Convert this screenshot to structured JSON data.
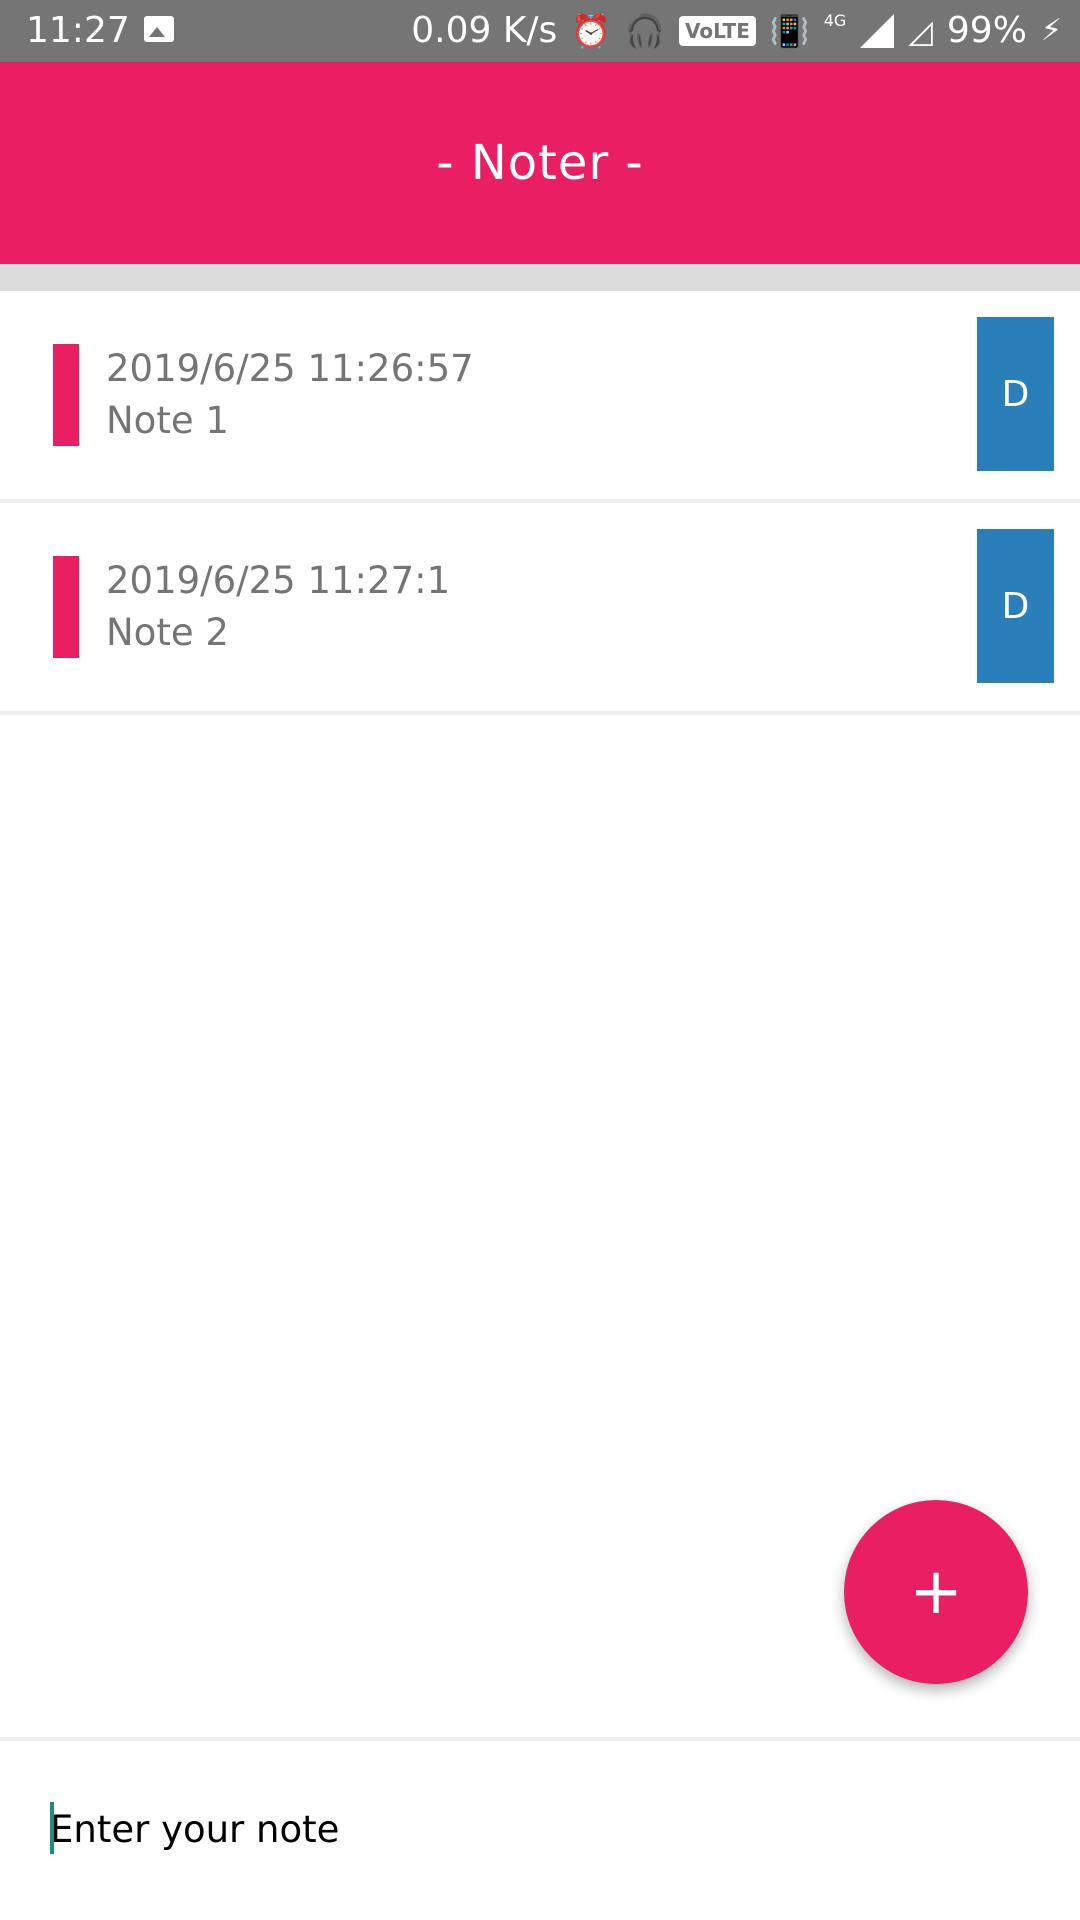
{
  "status_bar": {
    "time": "11:27",
    "net_speed": "0.09 K/s",
    "volte": "VoLTE",
    "network": "4G",
    "battery": "99%"
  },
  "app_bar": {
    "title": "- Noter -",
    "color": "#e91e63"
  },
  "notes": [
    {
      "date": "2019/6/25 11:26:57",
      "text": "Note 1",
      "delete_label": "D"
    },
    {
      "date": "2019/6/25 11:27:1",
      "text": "Note 2",
      "delete_label": "D"
    }
  ],
  "fab": {
    "label": "+"
  },
  "input": {
    "placeholder": "Enter your note",
    "value": ""
  },
  "colors": {
    "accent": "#e91e63",
    "delete_button": "#2a7fba",
    "status_bar": "#757575"
  }
}
